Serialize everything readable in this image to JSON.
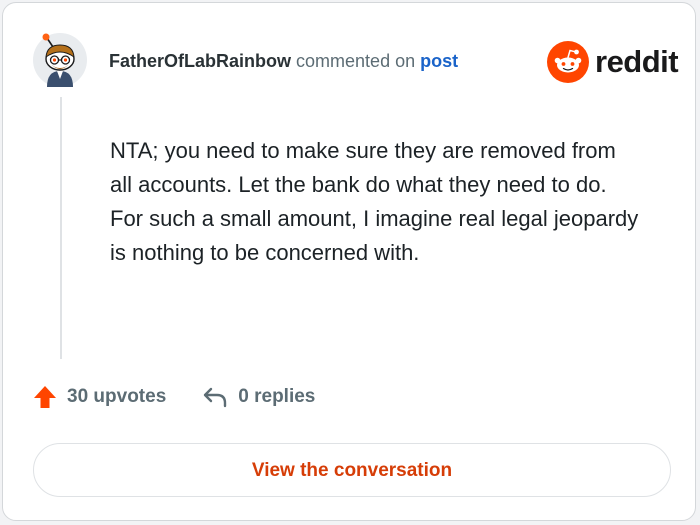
{
  "comment": {
    "author": "FatherOfLabRainbow",
    "action_text": "commented on",
    "post_link": "post",
    "body": "NTA; you need to make sure they are removed from all accounts. Let the bank do what they need to do. For such a small amount, I imagine real legal jeopardy is nothing to be concerned with."
  },
  "brand": {
    "name": "reddit",
    "icon": "reddit-snoo-icon"
  },
  "stats": {
    "upvotes": "30 upvotes",
    "replies": "0 replies"
  },
  "cta": {
    "label": "View the conversation"
  },
  "icons": {
    "upvote": "upvote-arrow-icon",
    "reply": "reply-arrow-icon",
    "avatar": "user-avatar"
  },
  "colors": {
    "accent": "#ff4500",
    "link": "#1a63c9",
    "cta_text": "#d63d07",
    "muted": "#5c6c74"
  }
}
